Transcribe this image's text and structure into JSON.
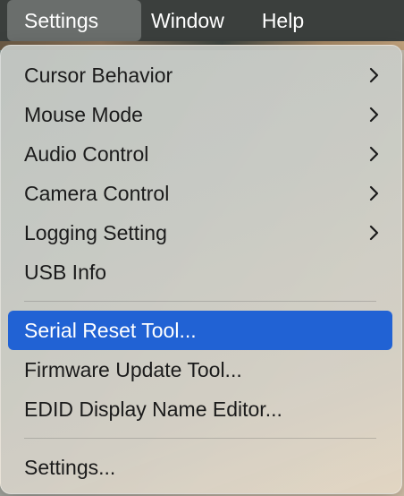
{
  "menubar": {
    "items": [
      {
        "label": "Settings",
        "active": true
      },
      {
        "label": "Window",
        "active": false
      },
      {
        "label": "Help",
        "active": false
      }
    ]
  },
  "menu": {
    "section1": [
      {
        "label": "Cursor Behavior",
        "submenu": true
      },
      {
        "label": "Mouse Mode",
        "submenu": true
      },
      {
        "label": "Audio Control",
        "submenu": true
      },
      {
        "label": "Camera Control",
        "submenu": true
      },
      {
        "label": "Logging Setting",
        "submenu": true
      },
      {
        "label": "USB Info",
        "submenu": false
      }
    ],
    "section2": [
      {
        "label": "Serial Reset Tool...",
        "highlighted": true
      },
      {
        "label": "Firmware Update Tool...",
        "highlighted": false
      },
      {
        "label": "EDID Display Name Editor...",
        "highlighted": false
      }
    ],
    "section3": [
      {
        "label": "Settings...",
        "highlighted": false
      }
    ]
  },
  "colors": {
    "highlight": "#2162d4",
    "menubar": "#3b3f3d",
    "menubar_active": "#6a6e6c"
  },
  "icons": {
    "submenu_indicator": "chevron-right-icon"
  }
}
